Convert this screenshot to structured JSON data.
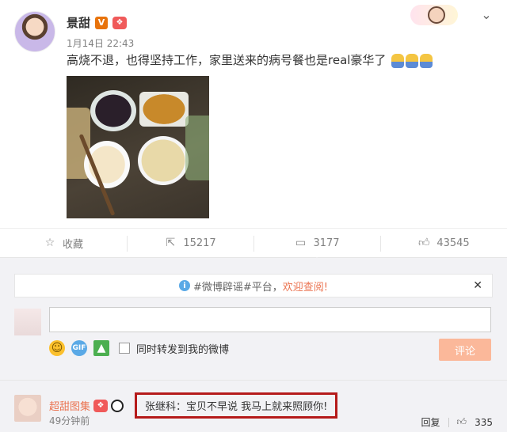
{
  "post": {
    "author": "景甜",
    "verified_badge": "V",
    "time": "1月14日 22:43",
    "text": "高烧不退，也得坚持工作，家里送来的病号餐也是real豪华了"
  },
  "actions": {
    "favorite": "收藏",
    "repost": "15217",
    "comment": "3177",
    "like": "43545"
  },
  "notice": {
    "prefix": "#微博辟谣#平台，",
    "link": "欢迎查阅!"
  },
  "composer": {
    "sync_label": "同时转发到我的微博",
    "submit_label": "评论"
  },
  "comment": {
    "user": "超甜图集",
    "text": "张继科：宝贝不早说 我马上就来照顾你!",
    "time": "49分钟前",
    "reply_label": "回复",
    "likes": "335"
  },
  "colors": {
    "accent": "#eb7350",
    "highlight_border": "#b51a1a",
    "background": "#f2f2f5"
  }
}
